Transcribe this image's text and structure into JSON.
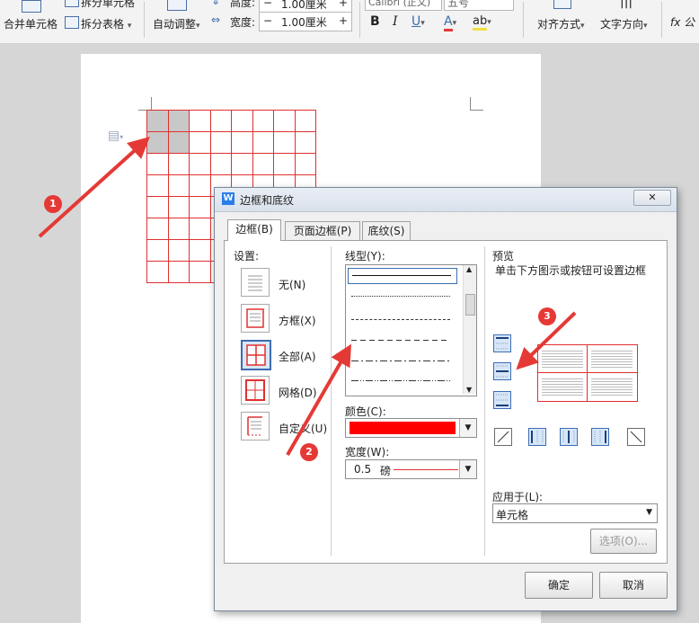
{
  "ribbon": {
    "merge_cells": "合并单元格",
    "split_cells": "拆分单元格",
    "split_table": "拆分表格",
    "auto_adjust": "自动调整",
    "height_label": "高度:",
    "height_value": "1.00厘米",
    "width_label": "宽度:",
    "width_value": "1.00厘米",
    "font_name": "Calibri (正文)",
    "font_size": "五号",
    "bold": "B",
    "italic": "I",
    "underline": "U",
    "font_color": "A",
    "highlight": "ab",
    "align_label": "对齐方式",
    "text_direction_label": "文字方向",
    "formula_label": "fx 公"
  },
  "document": {
    "table_rows": 8,
    "table_cols": 8,
    "selected_cells": [
      [
        0,
        0
      ],
      [
        0,
        1
      ],
      [
        1,
        0
      ],
      [
        1,
        1
      ]
    ],
    "table_border_color": "#e03030"
  },
  "dialog": {
    "title": "边框和底纹",
    "tabs": [
      {
        "label": "边框(B)",
        "active": true
      },
      {
        "label": "页面边框(P)",
        "active": false
      },
      {
        "label": "底纹(S)",
        "active": false
      }
    ],
    "settings": {
      "label": "设置:",
      "items": [
        {
          "label": "无(N)",
          "icon": "border-none-icon",
          "selected": false
        },
        {
          "label": "方框(X)",
          "icon": "border-box-icon",
          "selected": false
        },
        {
          "label": "全部(A)",
          "icon": "border-all-icon",
          "selected": true
        },
        {
          "label": "网格(D)",
          "icon": "border-grid-icon",
          "selected": false
        },
        {
          "label": "自定义(U)",
          "icon": "border-custom-icon",
          "selected": false
        }
      ]
    },
    "line_style": {
      "label": "线型(Y):",
      "styles": [
        "solid",
        "dotted",
        "dashed-small",
        "dashed",
        "dash-dot",
        "dash-dot-dot"
      ]
    },
    "color": {
      "label": "颜色(C):",
      "value": "#ff0000"
    },
    "width": {
      "label": "宽度(W):",
      "value": "0.5",
      "unit": "磅"
    },
    "preview": {
      "label": "预览",
      "hint": "单击下方图示或按钮可设置边框"
    },
    "apply_to": {
      "label": "应用于(L):",
      "value": "单元格"
    },
    "options_button": "选项(O)...",
    "ok_button": "确定",
    "cancel_button": "取消"
  },
  "markers": [
    "1",
    "2",
    "3"
  ],
  "colors": {
    "accent_red": "#e53935",
    "dialog_title_icon": "#2b7de9"
  }
}
